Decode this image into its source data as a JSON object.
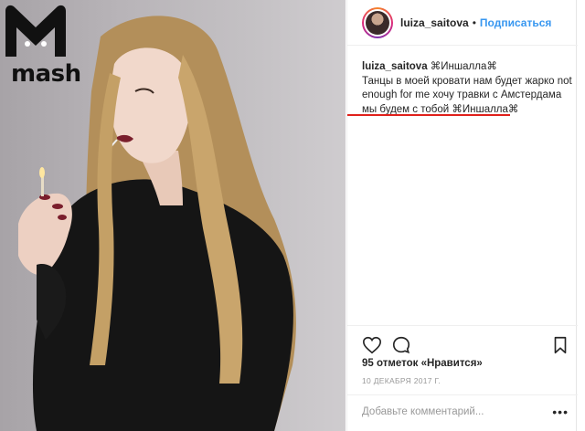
{
  "logo": {
    "text": "mash"
  },
  "post": {
    "username": "luiza_saitova",
    "follow_label": "Подписаться",
    "separator": "•",
    "caption": {
      "user": "luiza_saitova",
      "line1_rest": " ⁣⌘Иншалла⌘",
      "line2": "Танцы в моей кровати нам будет жарко not",
      "line3": "enough for me хочу травки с Амстердама",
      "line4": "мы будем с тобой ⌘Иншалла⌘"
    },
    "likes": "95 отметок «Нравится»",
    "date": "10 ДЕКАБРЯ 2017 Г.",
    "comment_placeholder": "Добавьте комментарий...",
    "more_label": "•••"
  },
  "icons": {
    "like": "heart-icon",
    "comment": "comment-bubble-icon",
    "save": "bookmark-icon"
  },
  "colors": {
    "follow": "#3897f0",
    "underline": "#e0201b",
    "text": "#262626",
    "muted": "#999999"
  }
}
